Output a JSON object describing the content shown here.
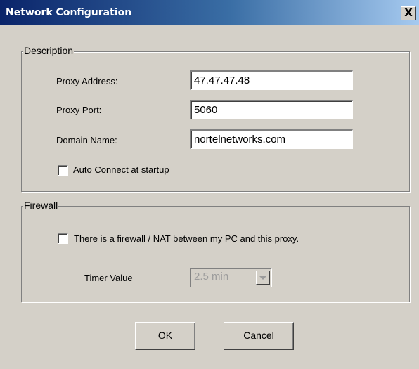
{
  "window": {
    "title": "Network Configuration",
    "close_glyph": "X"
  },
  "description": {
    "legend": "Description",
    "proxy_address": {
      "label": "Proxy Address:",
      "value": "47.47.47.48"
    },
    "proxy_port": {
      "label": "Proxy Port:",
      "value": "5060"
    },
    "domain_name": {
      "label": "Domain Name:",
      "value": "nortelnetworks.com"
    },
    "auto_connect": {
      "label": "Auto Connect at startup",
      "checked": false
    }
  },
  "firewall": {
    "legend": "Firewall",
    "nat_checkbox": {
      "label": "There is a firewall / NAT between my PC and this proxy.",
      "checked": false
    },
    "timer": {
      "label": "Timer Value",
      "value": "2.5 min",
      "disabled": true
    }
  },
  "buttons": {
    "ok": "OK",
    "cancel": "Cancel"
  },
  "icons": {
    "close": "close-icon",
    "dropdown": "chevron-down-icon"
  }
}
